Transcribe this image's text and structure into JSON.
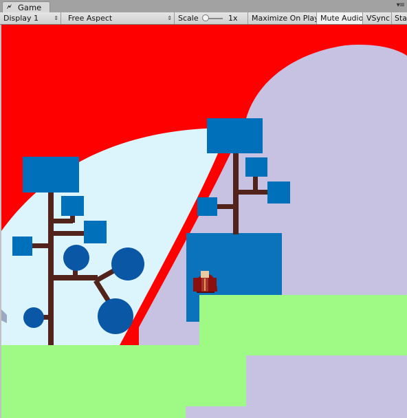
{
  "window": {
    "tab_label": "Game",
    "tab_icon": "unity-game-icon",
    "menu_icon": "panel-menu-icon"
  },
  "toolbar": {
    "display": "Display 1",
    "aspect": "Free Aspect",
    "scale_label": "Scale",
    "scale_value": "1x",
    "maximize": "Maximize On Play",
    "mute": "Mute Audio",
    "vsync": "VSync",
    "stats": "Sta"
  },
  "colors": {
    "sky": "#ff0000",
    "hill_light": "#dcf4fb",
    "hill_lavender": "#c8c2e2",
    "ground_green": "#9ef985",
    "leaf_blue": "#0170bb",
    "leaf_round": "#0a57a6",
    "trunk": "#51231a",
    "building_blue": "#0a73bb",
    "character_red": "#8a1010"
  }
}
